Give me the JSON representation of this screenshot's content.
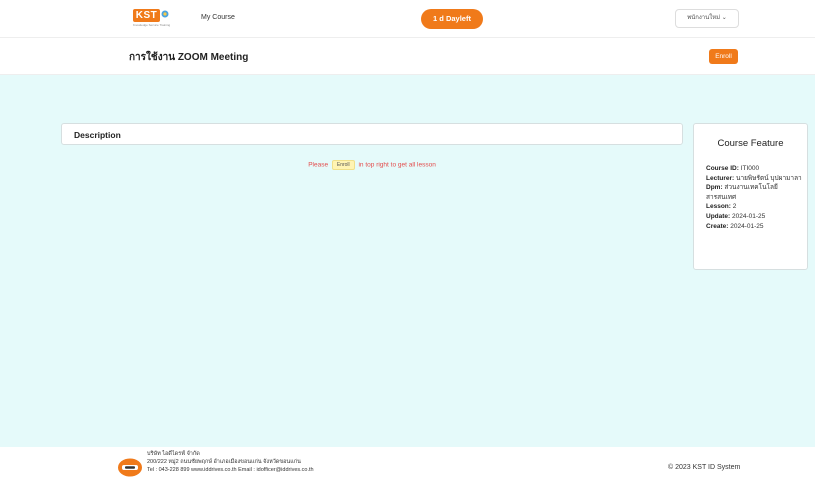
{
  "nav": {
    "logo_text": "KST",
    "logo_subtext": "Knowledge Service Training",
    "my_course": "My Course",
    "day_left": "1 d Dayleft",
    "user_menu": "พนักงานใหม่ ⌄"
  },
  "course": {
    "title": "การใช้งาน ZOOM Meeting",
    "enroll": "Enroll"
  },
  "description": {
    "title": "Description",
    "notice_before": "Please",
    "notice_badge": "Enroll",
    "notice_after": "in top right to get all lesson"
  },
  "feature": {
    "title": "Course Feature",
    "course_id_label": "Course ID:",
    "course_id": "ITI000",
    "lecturer_label": "Lecturer:",
    "lecturer": "นายพิษรัตน์ บุปผามาลา",
    "dpm_label": "Dpm:",
    "dpm": "ส่วนงานเทคโนโลยีสารสนเทศ",
    "lesson_label": "Lesson:",
    "lesson": "2",
    "update_label": "Update:",
    "update": "2024-01-25",
    "create_label": "Create:",
    "create": "2024-01-25"
  },
  "footer": {
    "company": "บริษัท ไอดีไดรฟ์ จำกัด",
    "address": "200/222 หมู่2 ถนนชัยพฤกษ์ อำเภอเมืองขอนแก่น จังหวัดขอนแก่น",
    "contact": "Tel : 043-228 899 www.iddrives.co.th Email : idofficer@iddrives.co.th",
    "copyright": "© 2023 KST ID System"
  },
  "colors": {
    "accent": "#f07a1a",
    "main_bg": "#e5fafa",
    "notice": "#e34b4b"
  }
}
